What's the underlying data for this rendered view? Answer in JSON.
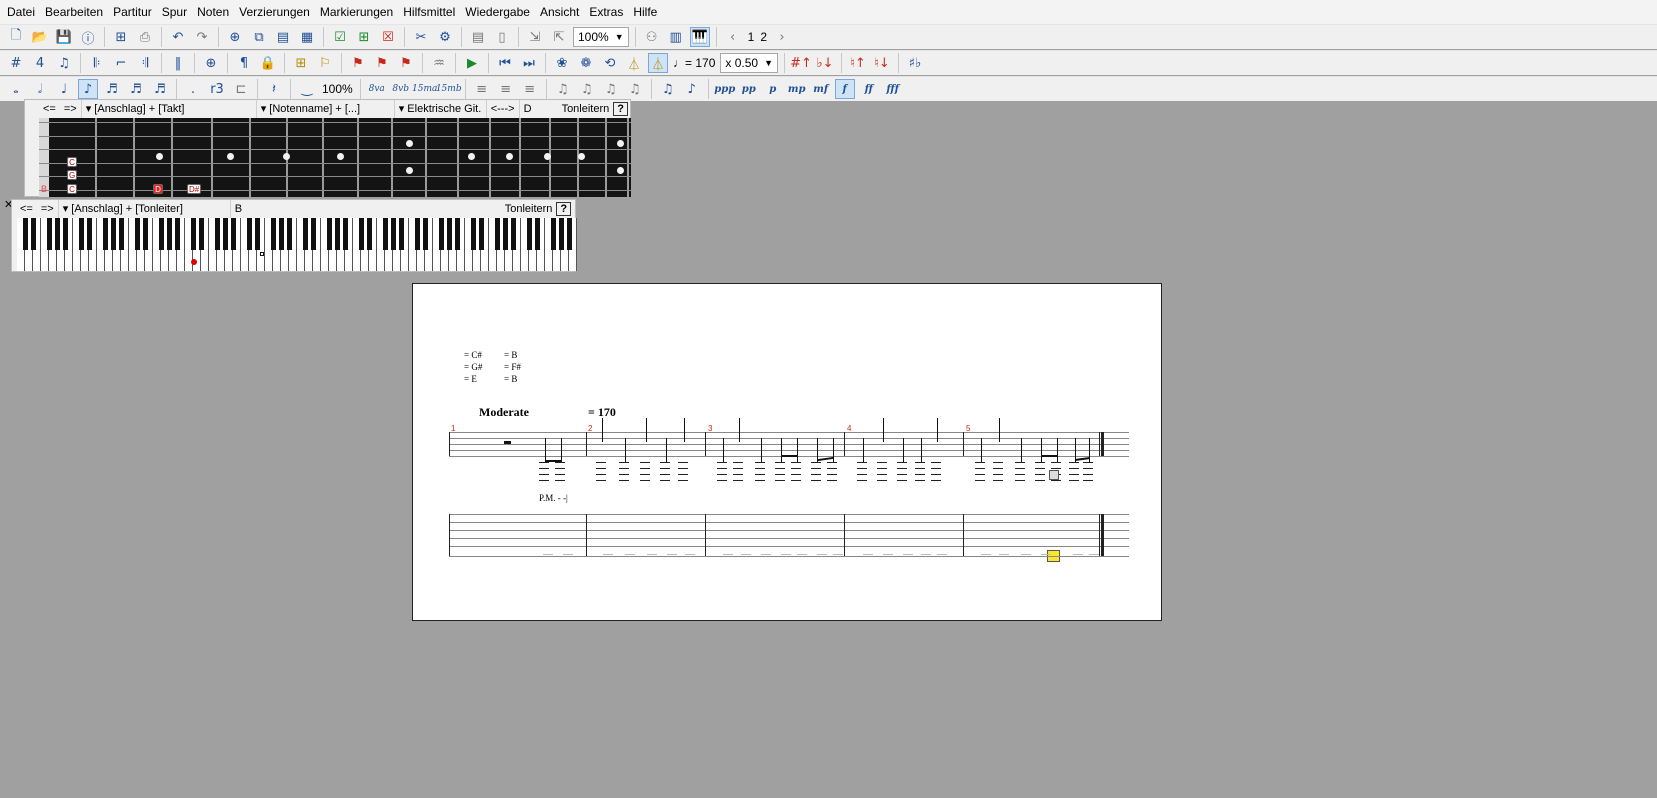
{
  "menu": [
    "Datei",
    "Bearbeiten",
    "Partitur",
    "Spur",
    "Noten",
    "Verzierungen",
    "Markierungen",
    "Hilfsmittel",
    "Wiedergabe",
    "Ansicht",
    "Extras",
    "Hilfe"
  ],
  "toolbar1": {
    "zoom": "100%",
    "pages": [
      "1",
      "2"
    ]
  },
  "toolbar2": {
    "tempo": "= 170",
    "speed": "x 0.50"
  },
  "toolbar3": {
    "percent": "100%",
    "octave_labels": [
      "8va",
      "8vb",
      "15ma",
      "15mb"
    ],
    "dynamics": [
      "ppp",
      "pp",
      "p",
      "mp",
      "mf",
      "f",
      "ff",
      "fff"
    ]
  },
  "fret_panel": {
    "nav_prev": "<=",
    "nav_next": "=>",
    "mode": "[Anschlag] + [Takt]",
    "naming": "[Notenname] + [...]",
    "instrument": "Elektrische Git.",
    "direction": "<--->",
    "key": "D",
    "scales_label": "Tonleitern",
    "help": "?",
    "open_string_label": "B",
    "markers": [
      {
        "label": "C",
        "active": false
      },
      {
        "label": "G",
        "active": false
      },
      {
        "label": "C",
        "active": false
      },
      {
        "label": "D",
        "active": true
      },
      {
        "label": "D#",
        "active": false
      }
    ]
  },
  "kb_panel": {
    "nav_prev": "<=",
    "nav_next": "=>",
    "mode": "[Anschlag] + [Tonleiter]",
    "key": "B",
    "scales_label": "Tonleitern",
    "help": "?"
  },
  "score": {
    "tuning": [
      [
        "= C#",
        "= B"
      ],
      [
        "= G#",
        "= F#"
      ],
      [
        "= E",
        "= B"
      ]
    ],
    "tempo_label": "Moderate",
    "tempo_value": "= 170",
    "bar_numbers": [
      "1",
      "2",
      "3",
      "4",
      "5"
    ],
    "pm_label": "P.M. - -|"
  },
  "colors": {
    "accent": "#1f4f96",
    "bar_number": "#c62a1d",
    "cursor": "#ffe62a",
    "workspace": "#a0a0a0"
  }
}
